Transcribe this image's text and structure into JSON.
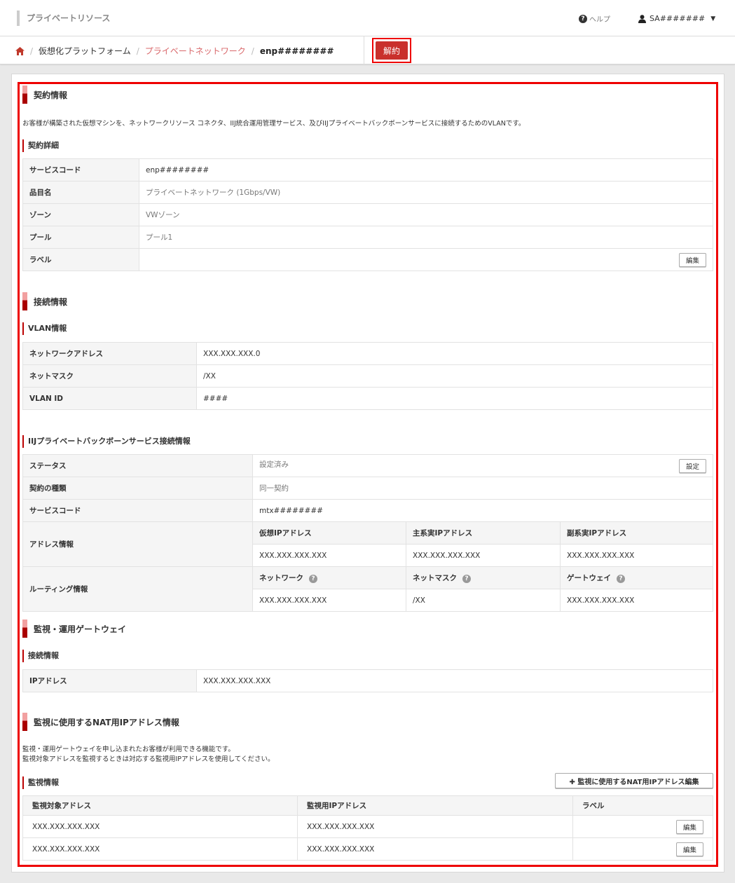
{
  "header": {
    "app_title": "プライベートリソース",
    "help_label": "ヘルプ",
    "user_label": "SA#######"
  },
  "breadcrumb": {
    "items": [
      "仮想化プラットフォーム",
      "プライベートネットワーク",
      "enp########"
    ]
  },
  "actions": {
    "cancel_label": "解約"
  },
  "contract": {
    "heading": "契約情報",
    "description": "お客様が構築された仮想マシンを、ネットワークリソース コネクタ、IIJ統合運用管理サービス、及びIIJプライベートバックボーンサービスに接続するためのVLANです。",
    "detail_heading": "契約詳細",
    "rows": [
      {
        "label": "サービスコード",
        "value": "enp########"
      },
      {
        "label": "品目名",
        "value": "プライベートネットワーク (1Gbps/VW)"
      },
      {
        "label": "ゾーン",
        "value": "VWゾーン"
      },
      {
        "label": "プール",
        "value": "プール1"
      },
      {
        "label": "ラベル",
        "value": ""
      }
    ],
    "edit_label": "編集"
  },
  "connection": {
    "heading": "接続情報",
    "vlan_heading": "VLAN情報",
    "vlan_rows": [
      {
        "label": "ネットワークアドレス",
        "value": "XXX.XXX.XXX.0"
      },
      {
        "label": "ネットマスク",
        "value": "/XX"
      },
      {
        "label": "VLAN ID",
        "value": "####"
      }
    ],
    "pbb_heading": "IIJプライベートバックボーンサービス接続情報",
    "status_label": "ステータス",
    "status_value": "設定済み",
    "setting_label": "設定",
    "contract_type_label": "契約の種類",
    "contract_type_value": "同一契約",
    "service_code_label": "サービスコード",
    "service_code_value": "mtx########",
    "address_label": "アドレス情報",
    "address_headers": [
      "仮想IPアドレス",
      "主系実IPアドレス",
      "副系実IPアドレス"
    ],
    "address_values": [
      "XXX.XXX.XXX.XXX",
      "XXX.XXX.XXX.XXX",
      "XXX.XXX.XXX.XXX"
    ],
    "routing_label": "ルーティング情報",
    "routing_headers": [
      "ネットワーク",
      "ネットマスク",
      "ゲートウェイ"
    ],
    "routing_values": [
      "XXX.XXX.XXX.XXX",
      "/XX",
      "XXX.XXX.XXX.XXX"
    ]
  },
  "gateway": {
    "heading": "監視・運用ゲートウェイ",
    "sub_heading": "接続情報",
    "ip_label": "IPアドレス",
    "ip_value": "XXX.XXX.XXX.XXX"
  },
  "nat": {
    "heading": "監視に使用するNAT用IPアドレス情報",
    "desc_line1": "監視・運用ゲートウェイを申し込まれたお客様が利用できる機能です。",
    "desc_line2": "監視対象アドレスを監視するときは対応する監視用IPアドレスを使用してください。",
    "sub_heading": "監視情報",
    "edit_button": "監視に使用するNAT用IPアドレス編集",
    "columns": [
      "監視対象アドレス",
      "監視用IPアドレス",
      "ラベル"
    ],
    "rows": [
      {
        "target": "XXX.XXX.XXX.XXX",
        "monitor": "XXX.XXX.XXX.XXX",
        "label": ""
      },
      {
        "target": "XXX.XXX.XXX.XXX",
        "monitor": "XXX.XXX.XXX.XXX",
        "label": ""
      }
    ],
    "row_edit_label": "編集"
  }
}
